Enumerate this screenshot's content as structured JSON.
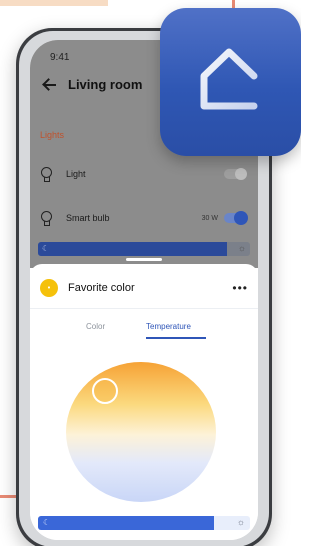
{
  "status_bar": {
    "time": "9:41"
  },
  "header": {
    "title": "Living room"
  },
  "lights": {
    "section_label": "Lights",
    "devices": [
      {
        "label": "Light",
        "on": false
      },
      {
        "label": "Smart bulb",
        "power": "30 W",
        "on": true
      }
    ],
    "brightness_level_percent": 89
  },
  "sheet": {
    "title": "Favorite color",
    "tabs": [
      {
        "label": "Color",
        "active": false
      },
      {
        "label": "Temperature",
        "active": true
      }
    ],
    "brightness_level_percent": 83
  },
  "icons": [
    "back-arrow-icon",
    "lightbulb-icon",
    "more-options-icon",
    "moon-icon",
    "sun-icon",
    "home-app-icon"
  ],
  "colors": {
    "accent_blue": "#2f56b8",
    "section_label": "#c0522c",
    "favorite_badge": "#f5c10b",
    "warm_orange": "#f6a235",
    "cool_blue": "#c9d6f7"
  }
}
